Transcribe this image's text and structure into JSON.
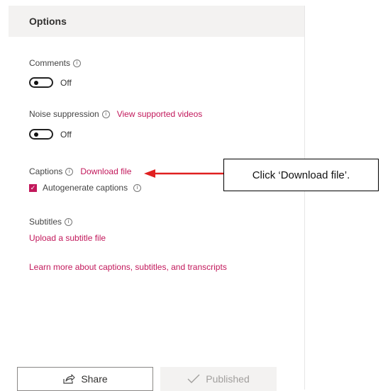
{
  "panel": {
    "title": "Options",
    "comments": {
      "label": "Comments",
      "state": "Off"
    },
    "noise": {
      "label": "Noise suppression",
      "link": "View supported videos",
      "state": "Off"
    },
    "captions": {
      "label": "Captions",
      "link": "Download file",
      "autogen_label": "Autogenerate captions",
      "autogen_checked": true
    },
    "subtitles": {
      "label": "Subtitles",
      "link": "Upload a subtitle file"
    },
    "learn_more": "Learn more about captions, subtitles, and transcripts",
    "share_label": "Share",
    "published_label": "Published"
  },
  "annotation": {
    "text": "Click ‘Download file’.",
    "arrow_color": "#e02020"
  },
  "colors": {
    "accent": "#c2185b",
    "header_bg": "#f3f2f1"
  }
}
